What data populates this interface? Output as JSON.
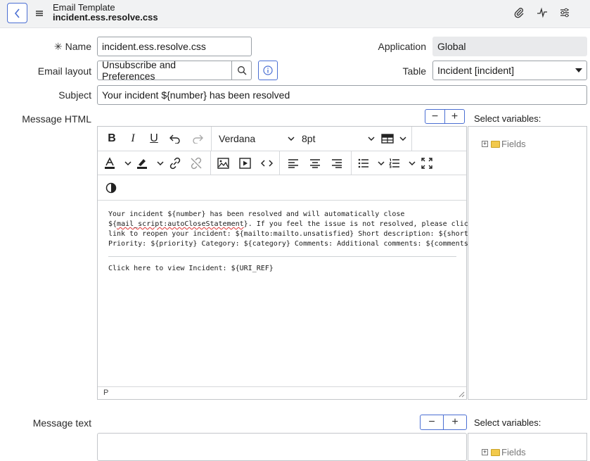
{
  "header": {
    "title_line1": "Email Template",
    "title_line2": "incident.ess.resolve.css",
    "icons": [
      "paperclip-icon",
      "activity-icon",
      "sliders-icon"
    ]
  },
  "form": {
    "name_label": "Name",
    "name_required_marker": "✳",
    "name_value": "incident.ess.resolve.css",
    "application_label": "Application",
    "application_value": "Global",
    "email_layout_label": "Email layout",
    "email_layout_value": "Unsubscribe and Preferences",
    "table_label": "Table",
    "table_value": "Incident [incident]",
    "subject_label": "Subject",
    "subject_value": "Your incident ${number} has been resolved",
    "message_html_label": "Message HTML",
    "message_text_label": "Message text",
    "select_variables_label": "Select variables:",
    "fields_tree_label": "Fields"
  },
  "editor": {
    "font_family": "Verdana",
    "font_size": "8pt",
    "status_path": "P",
    "content_lines": [
      "Your incident ${number} has been resolved and will automatically close",
      "${mail_script:autoCloseStatement}. If you feel the issue is not resolved, please click the following",
      "link to reopen your incident: ${mailto:mailto.unsatisfied} Short description: ${short_description}",
      "Priority: ${priority} Category: ${category} Comments: Additional comments: ${comments}"
    ],
    "line2_misspelled": "mail_script:autoCloseStatement",
    "line2_prefix": "${",
    "line2_suffix": "}. If you feel the issue is not resolved, please click the following",
    "footer_line": "Click here to view Incident: ${URI_REF}"
  },
  "colors": {
    "accent": "#4b6fd3",
    "header_bg": "#f1f2f3",
    "readonly_bg": "#e9eaec",
    "folder": "#f2c94c"
  }
}
